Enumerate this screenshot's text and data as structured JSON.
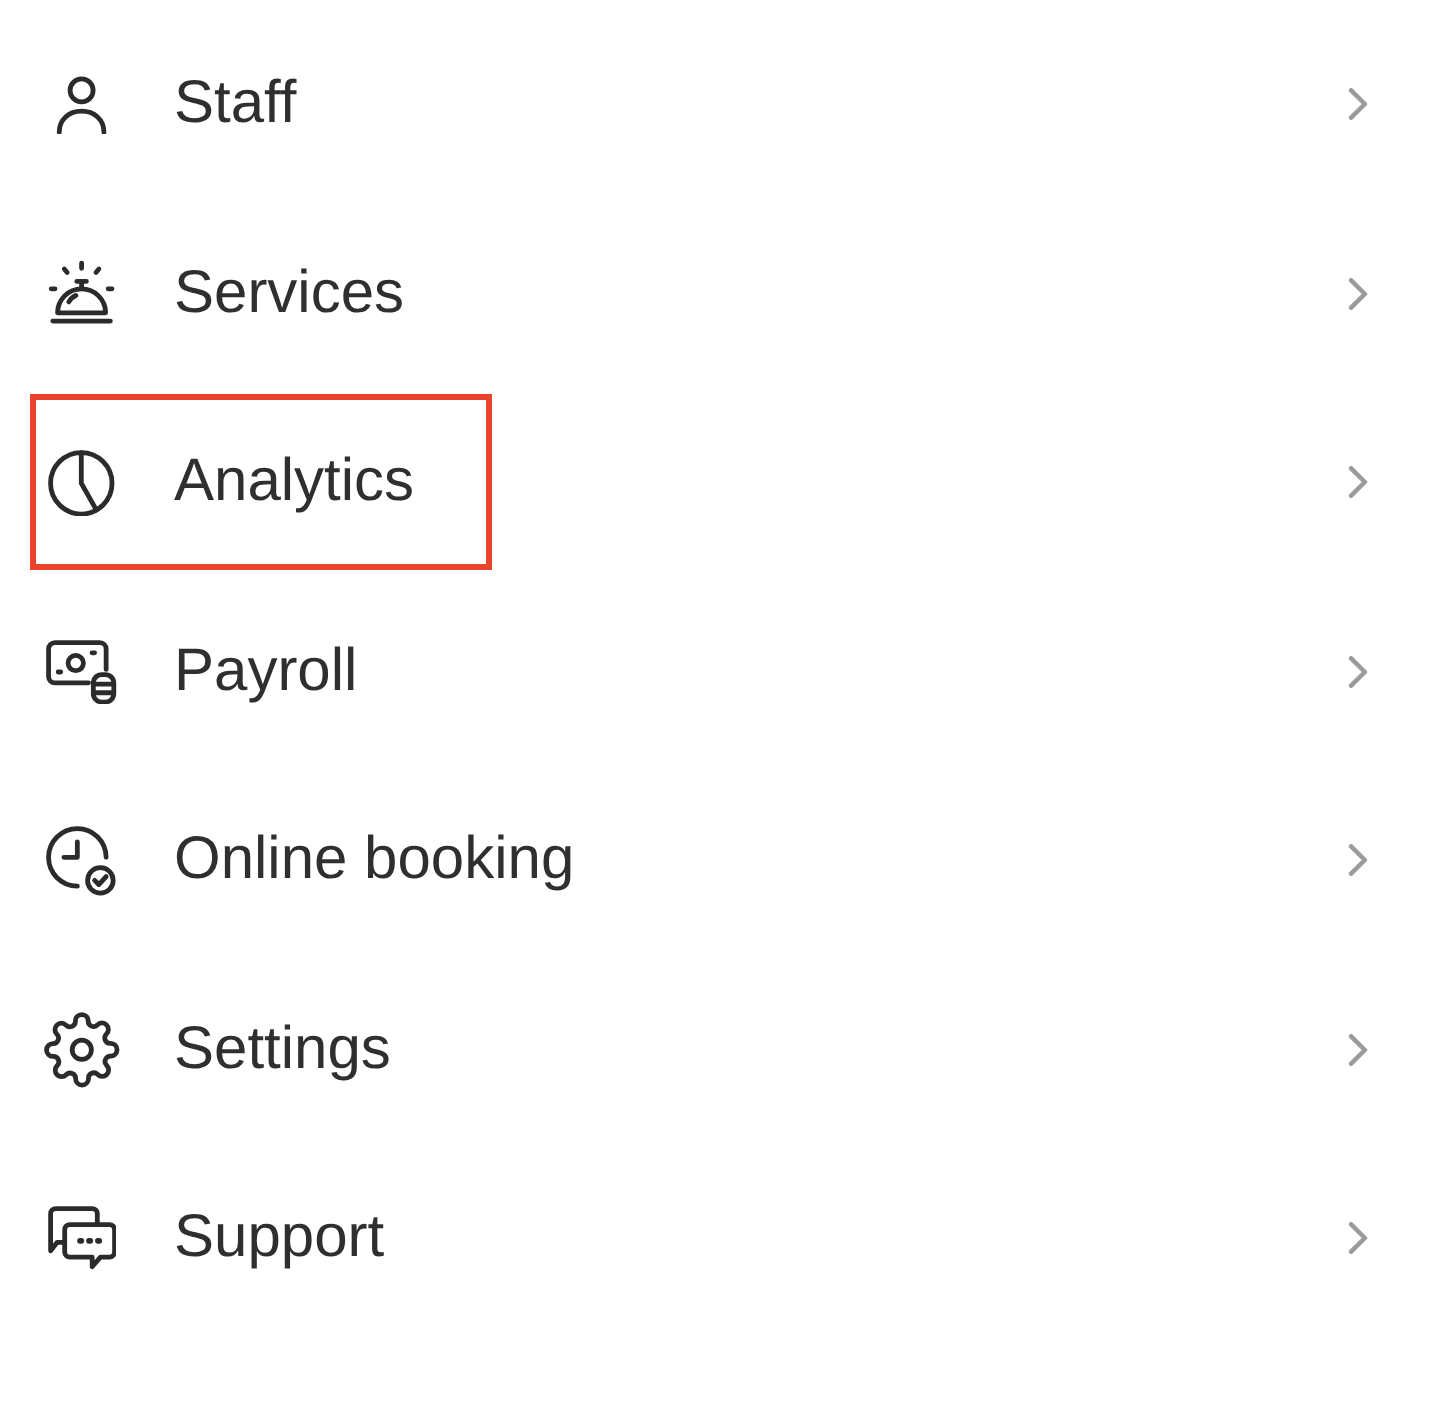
{
  "menu": {
    "items": [
      {
        "label": "Staff",
        "highlighted": false
      },
      {
        "label": "Services",
        "highlighted": false
      },
      {
        "label": "Analytics",
        "highlighted": true
      },
      {
        "label": "Payroll",
        "highlighted": false
      },
      {
        "label": "Online booking",
        "highlighted": false
      },
      {
        "label": "Settings",
        "highlighted": false
      },
      {
        "label": "Support",
        "highlighted": false
      }
    ]
  }
}
